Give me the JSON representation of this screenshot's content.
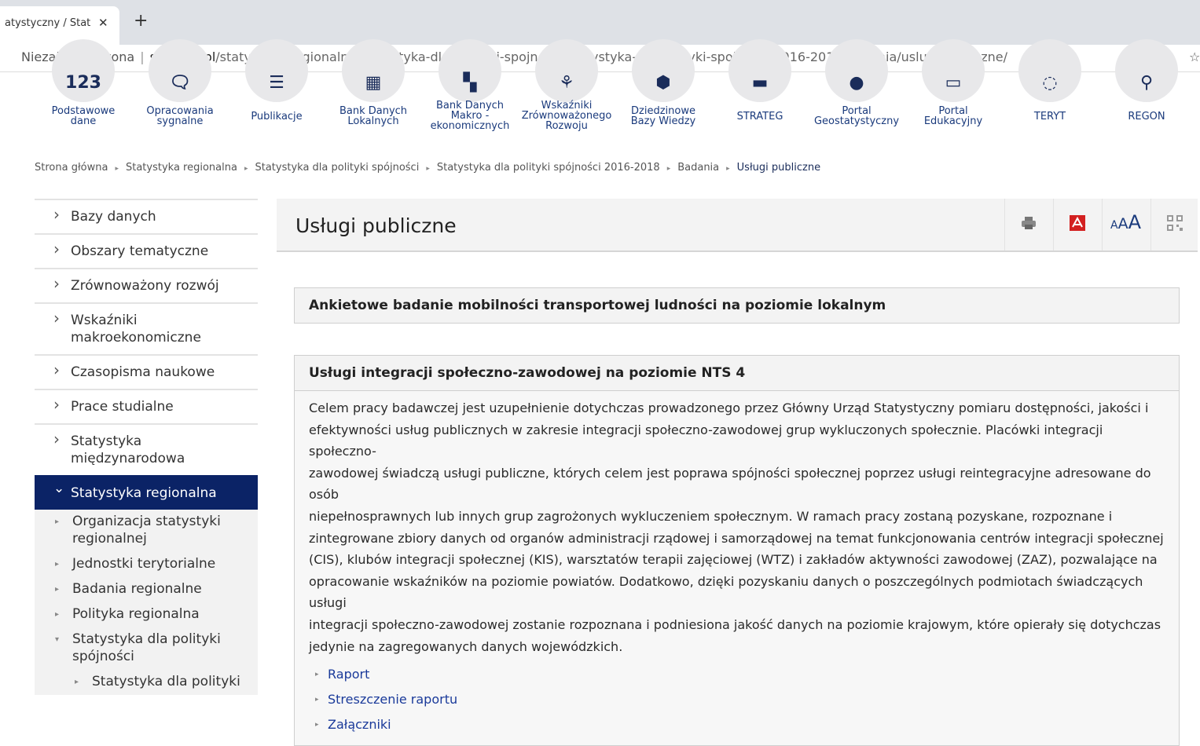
{
  "browser": {
    "tab_title": "atystyczny / Stat",
    "tab_close": "✕",
    "new_tab": "+",
    "security": "Niezabezpieczona",
    "url_host": "stat.gov.pl",
    "url_path": "/statystyka-regionalna/statystyka-dla-polityki-spojnosci/statystyka-dla-polityki-spojnosci-2016-2018/badania/uslugi-publiczne/",
    "bookmark": "☆"
  },
  "iconnav": [
    {
      "glyph": "123",
      "label_lines": [
        "Podstawowe",
        "dane"
      ]
    },
    {
      "glyph": "🗨",
      "label_lines": [
        "Opracowania",
        "sygnalne"
      ]
    },
    {
      "glyph": "☰",
      "label_lines": [
        "Publikacje"
      ]
    },
    {
      "glyph": "▦",
      "label_lines": [
        "Bank Danych",
        "Lokalnych"
      ]
    },
    {
      "glyph": "▚",
      "label_lines": [
        "Bank Danych",
        "Makro -",
        "ekonomicznych"
      ]
    },
    {
      "glyph": "⚘",
      "label_lines": [
        "Wskaźniki",
        "Zrównoważonego",
        "Rozwoju"
      ]
    },
    {
      "glyph": "⬢",
      "label_lines": [
        "Dziedzinowe",
        "Bazy Wiedzy"
      ]
    },
    {
      "glyph": "▬",
      "label_lines": [
        "STRATEG"
      ]
    },
    {
      "glyph": "●",
      "label_lines": [
        "Portal",
        "Geostatystyczny"
      ]
    },
    {
      "glyph": "▭",
      "label_lines": [
        "Portal",
        "Edukacyjny"
      ]
    },
    {
      "glyph": "◌",
      "label_lines": [
        "TERYT"
      ]
    },
    {
      "glyph": "⚲",
      "label_lines": [
        "REGON"
      ]
    }
  ],
  "breadcrumb": [
    "Strona główna",
    "Statystyka regionalna",
    "Statystyka dla polityki spójności",
    "Statystyka dla polityki spójności 2016-2018",
    "Badania",
    "Usługi publiczne"
  ],
  "sidebar": {
    "items": [
      {
        "label": "Bazy danych"
      },
      {
        "label": "Obszary tematyczne"
      },
      {
        "label": "Zrównoważony rozwój"
      },
      {
        "label": "Wskaźniki makroekonomiczne"
      },
      {
        "label": "Czasopisma naukowe"
      },
      {
        "label": "Prace studialne"
      },
      {
        "label": "Statystyka międzynarodowa"
      },
      {
        "label": "Statystyka regionalna"
      }
    ],
    "subitems": [
      {
        "label": "Organizacja statystyki regionalnej"
      },
      {
        "label": "Jednostki terytorialne"
      },
      {
        "label": "Badania regionalne"
      },
      {
        "label": "Polityka regionalna"
      },
      {
        "label": "Statystyka dla polityki spójności"
      }
    ],
    "subsubitems": [
      {
        "label": "Statystyka dla polityki"
      }
    ]
  },
  "main": {
    "title": "Usługi publiczne",
    "tools": {
      "font_small": "A",
      "font_medium": "A",
      "font_large": "A"
    },
    "sections": [
      {
        "title": "Ankietowe badanie mobilności transportowej ludności na poziomie lokalnym"
      },
      {
        "title": "Usługi integracji społeczno-zawodowej na poziomie NTS 4",
        "lines": [
          "Celem pracy badawczej jest uzupełnienie dotychczas prowadzonego przez Główny Urząd Statystyczny pomiaru dostępności, jakości i",
          "efektywności usług publicznych w zakresie integracji społeczno-zawodowej grup wykluczonych społecznie. Placówki integracji społeczno-",
          "zawodowej świadczą usługi publiczne, których celem jest poprawa spójności społecznej poprzez usługi reintegracyjne adresowane do osób",
          "niepełnosprawnych lub innych grup zagrożonych wykluczeniem społecznym. W ramach pracy zostaną pozyskane, rozpoznane i",
          "zintegrowane zbiory danych od organów administracji rządowej i samorządowej na temat funkcjonowania centrów integracji społecznej",
          "(CIS), klubów integracji społecznej (KIS), warsztatów terapii zajęciowej (WTZ) i zakładów aktywności zawodowej (ZAZ), pozwalające na",
          "opracowanie wskaźników na poziomie powiatów. Dodatkowo, dzięki pozyskaniu danych o poszczególnych podmiotach świadczących usługi",
          "integracji społeczno-zawodowej zostanie rozpoznana i podniesiona jakość danych na poziomie krajowym, które opierały się dotychczas",
          "jedynie na zagregowanych danych wojewódzkich."
        ],
        "links": [
          "Raport",
          "Streszczenie raportu",
          "Załączniki"
        ]
      }
    ]
  },
  "colors": {
    "active_nav": "#0b2366",
    "pdf_red": "#d32020",
    "link": "#1a3a9a"
  }
}
